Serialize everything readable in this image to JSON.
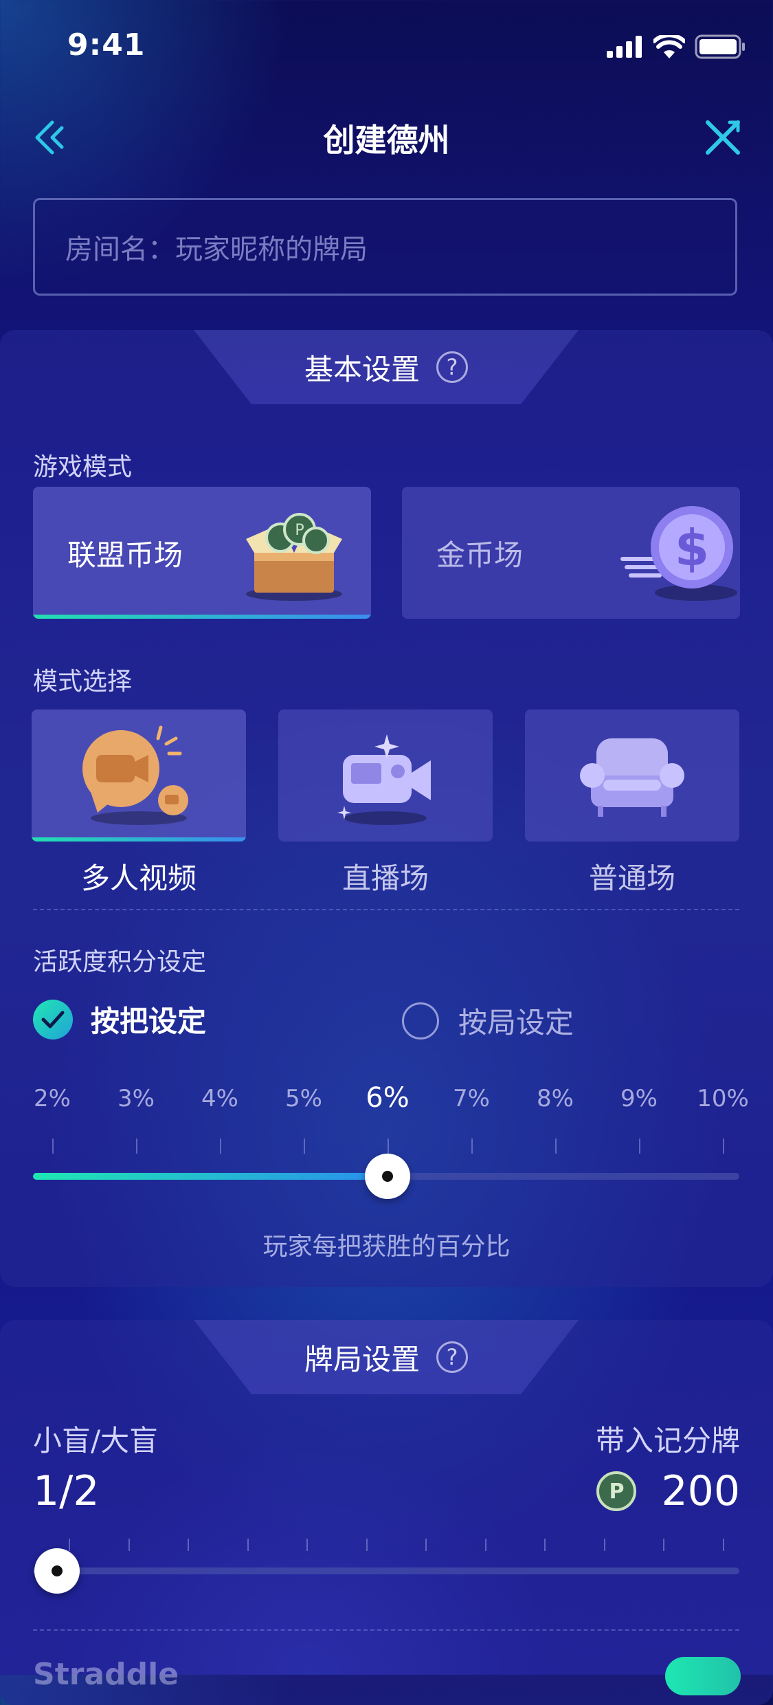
{
  "status_bar": {
    "time": "9:41"
  },
  "header": {
    "title": "创建德州"
  },
  "room_input": {
    "placeholder": "房间名：玩家昵称的牌局"
  },
  "basic_settings": {
    "title": "基本设置",
    "help": "?",
    "game_mode": {
      "label": "游戏模式",
      "options": [
        {
          "label": "联盟币场",
          "selected": true
        },
        {
          "label": "金币场",
          "selected": false
        }
      ]
    },
    "mode_select": {
      "label": "模式选择",
      "options": [
        {
          "label": "多人视频",
          "selected": true
        },
        {
          "label": "直播场",
          "selected": false
        },
        {
          "label": "普通场",
          "selected": false
        }
      ]
    },
    "activity": {
      "label": "活跃度积分设定",
      "options": [
        {
          "label": "按把设定",
          "checked": true
        },
        {
          "label": "按局设定",
          "checked": false
        }
      ],
      "ticks": [
        "2%",
        "3%",
        "4%",
        "5%",
        "6%",
        "7%",
        "8%",
        "9%",
        "10%"
      ],
      "selected_index": 4,
      "caption": "玩家每把获胜的百分比"
    }
  },
  "game_settings": {
    "title": "牌局设置",
    "help": "?",
    "blinds": {
      "label": "小盲/大盲",
      "value": "1/2",
      "level": 0
    },
    "buyin": {
      "label": "带入记分牌",
      "value": "200",
      "coin_symbol": "P"
    },
    "straddle": {
      "label": "Straddle",
      "enabled": true
    }
  },
  "colors": {
    "accent_start": "#1ee7b2",
    "accent_end": "#2a8fee"
  }
}
